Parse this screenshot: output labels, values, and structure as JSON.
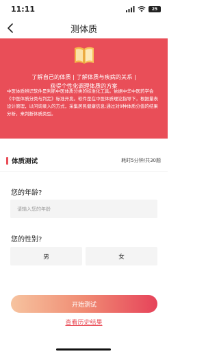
{
  "status": {
    "time": "11:11",
    "battery": "25"
  },
  "nav": {
    "title": "测体质"
  },
  "hero": {
    "line1": "了解自己的体质 | 了解体质与疾病的关系 |",
    "line2": "获得个性化调理体质的方案",
    "desc": "中医体质辨识软件是判断中医体质分类的标准化工具。依据中华中医药学会《中医体质分类与判定》标准开发。软件是在中医体质理论指导下，根据量表设计原理，以问询录入的方式，采集居民健康信息;通过对9种体质分值的结果分析，来判断体质类型。"
  },
  "section": {
    "title": "体质测试",
    "meta": "耗时5分钟/共30题"
  },
  "age": {
    "label": "您的年龄?",
    "placeholder": "请输入您的年龄"
  },
  "gender": {
    "label": "您的性别?",
    "male": "男",
    "female": "女"
  },
  "actions": {
    "start": "开始测试",
    "history": "查看历史结果"
  }
}
